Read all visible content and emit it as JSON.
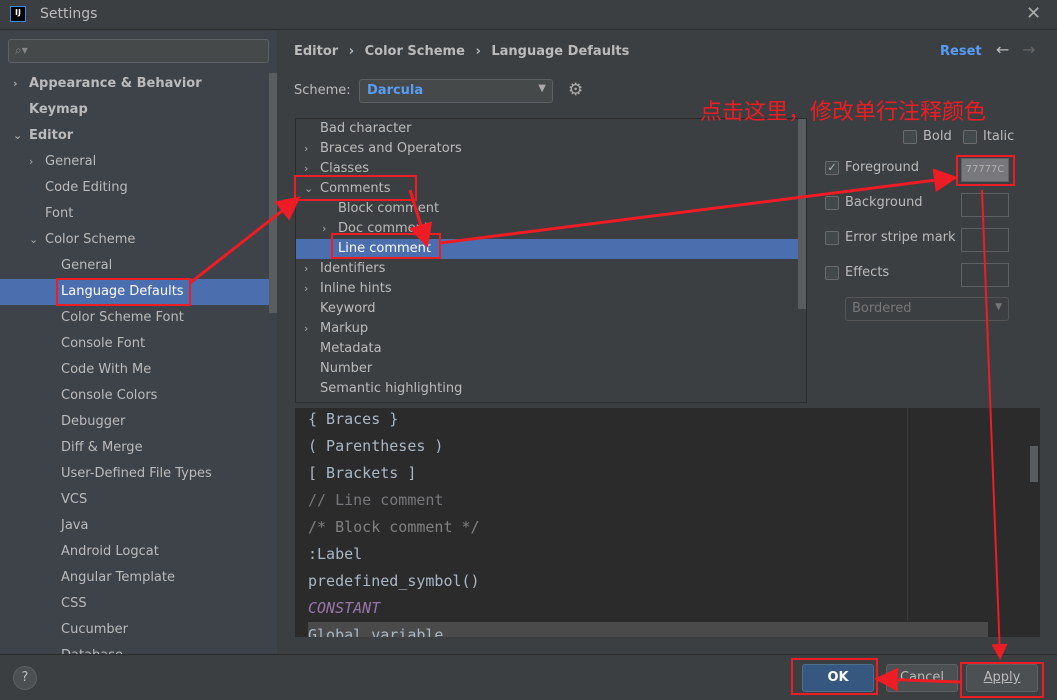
{
  "window": {
    "title": "Settings",
    "logo": "IJ",
    "close_icon": "close-icon"
  },
  "sidebar": {
    "search_placeholder": "",
    "items": [
      {
        "label": "Appearance & Behavior",
        "level": 0,
        "bold": true,
        "chevron": "right"
      },
      {
        "label": "Keymap",
        "level": 0,
        "bold": true,
        "chevron": ""
      },
      {
        "label": "Editor",
        "level": 0,
        "bold": true,
        "chevron": "down"
      },
      {
        "label": "General",
        "level": 1,
        "chevron": "right"
      },
      {
        "label": "Code Editing",
        "level": 1,
        "chevron": ""
      },
      {
        "label": "Font",
        "level": 1,
        "chevron": ""
      },
      {
        "label": "Color Scheme",
        "level": 1,
        "chevron": "down"
      },
      {
        "label": "General",
        "level": 2,
        "chevron": ""
      },
      {
        "label": "Language Defaults",
        "level": 2,
        "chevron": "",
        "selected": true
      },
      {
        "label": "Color Scheme Font",
        "level": 2,
        "chevron": ""
      },
      {
        "label": "Console Font",
        "level": 2,
        "chevron": ""
      },
      {
        "label": "Code With Me",
        "level": 2,
        "chevron": ""
      },
      {
        "label": "Console Colors",
        "level": 2,
        "chevron": ""
      },
      {
        "label": "Debugger",
        "level": 2,
        "chevron": ""
      },
      {
        "label": "Diff & Merge",
        "level": 2,
        "chevron": ""
      },
      {
        "label": "User-Defined File Types",
        "level": 2,
        "chevron": ""
      },
      {
        "label": "VCS",
        "level": 2,
        "chevron": ""
      },
      {
        "label": "Java",
        "level": 2,
        "chevron": ""
      },
      {
        "label": "Android Logcat",
        "level": 2,
        "chevron": ""
      },
      {
        "label": "Angular Template",
        "level": 2,
        "chevron": ""
      },
      {
        "label": "CSS",
        "level": 2,
        "chevron": ""
      },
      {
        "label": "Cucumber",
        "level": 2,
        "chevron": ""
      },
      {
        "label": "Database",
        "level": 2,
        "chevron": ""
      }
    ]
  },
  "header": {
    "breadcrumb": [
      "Editor",
      "Color Scheme",
      "Language Defaults"
    ],
    "reset": "Reset"
  },
  "scheme": {
    "label": "Scheme:",
    "value": "Darcula"
  },
  "tree": [
    {
      "label": "Bad character",
      "level": 0,
      "chevron": ""
    },
    {
      "label": "Braces and Operators",
      "level": 0,
      "chevron": "right"
    },
    {
      "label": "Classes",
      "level": 0,
      "chevron": "right"
    },
    {
      "label": "Comments",
      "level": 0,
      "chevron": "down"
    },
    {
      "label": "Block comment",
      "level": 1,
      "chevron": ""
    },
    {
      "label": "Doc comment",
      "level": 1,
      "chevron": "right"
    },
    {
      "label": "Line comment",
      "level": 1,
      "chevron": "",
      "selected": true
    },
    {
      "label": "Identifiers",
      "level": 0,
      "chevron": "right"
    },
    {
      "label": "Inline hints",
      "level": 0,
      "chevron": "right"
    },
    {
      "label": "Keyword",
      "level": 0,
      "chevron": ""
    },
    {
      "label": "Markup",
      "level": 0,
      "chevron": "right"
    },
    {
      "label": "Metadata",
      "level": 0,
      "chevron": ""
    },
    {
      "label": "Number",
      "level": 0,
      "chevron": ""
    },
    {
      "label": "Semantic highlighting",
      "level": 0,
      "chevron": ""
    }
  ],
  "attributes": {
    "bold": "Bold",
    "italic": "Italic",
    "foreground": "Foreground",
    "foreground_checked": true,
    "foreground_color": "77777C",
    "background": "Background",
    "error_stripe": "Error stripe mark",
    "effects": "Effects",
    "effect_type": "Bordered"
  },
  "preview": [
    {
      "text": "{ Braces }",
      "color": "#a9b7c6"
    },
    {
      "text": "( Parentheses )",
      "color": "#a9b7c6"
    },
    {
      "text": "[ Brackets ]",
      "color": "#a9b7c6"
    },
    {
      "text": "// Line comment",
      "color": "#77777c"
    },
    {
      "text": "/* Block comment */",
      "color": "#808080"
    },
    {
      "text": ":Label",
      "color": "#a9b7c6"
    },
    {
      "text": "predefined_symbol()",
      "color": "#a9b7c6"
    },
    {
      "text": "CONSTANT",
      "color": "#9876aa",
      "italic": true
    },
    {
      "text": "Global variable",
      "color": "#a9b7c6",
      "highlight": true
    }
  ],
  "buttons": {
    "help": "?",
    "ok": "OK",
    "cancel": "Cancel",
    "apply": "Apply"
  },
  "annotation": {
    "text": "点击这里，修改单行注释颜色",
    "color": "#ee1c24"
  },
  "colors": {
    "selection": "#4b6eaf",
    "accent": "#589df6"
  }
}
